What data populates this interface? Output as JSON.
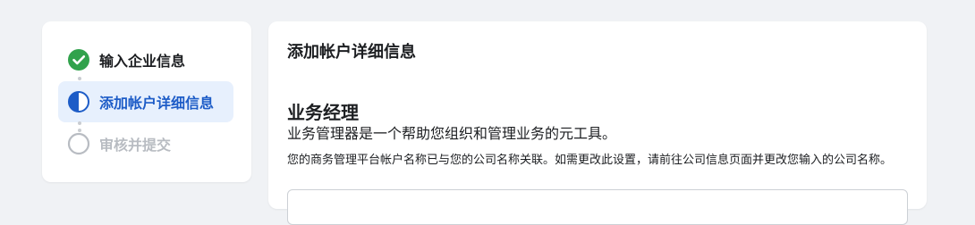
{
  "stepper": {
    "steps": [
      {
        "label": "输入企业信息",
        "status": "done",
        "icon": "check-circle-icon"
      },
      {
        "label": "添加帐户详细信息",
        "status": "active",
        "icon": "half-circle-icon"
      },
      {
        "label": "审核并提交",
        "status": "pending",
        "icon": "empty-circle-icon"
      }
    ]
  },
  "panel": {
    "title": "添加帐户详细信息",
    "section_title": "业务经理",
    "section_subtitle": "业务管理器是一个帮助您组织和管理业务的元工具。",
    "note": "您的商务管理平台帐户名称已与您的公司名称关联。如需更改此设置，请前往公司信息页面并更改您输入的公司名称。"
  },
  "colors": {
    "done": "#31a24c",
    "active": "#1d5cc7",
    "pending": "#b8bcc2",
    "active_bg": "#e7f0fd"
  }
}
